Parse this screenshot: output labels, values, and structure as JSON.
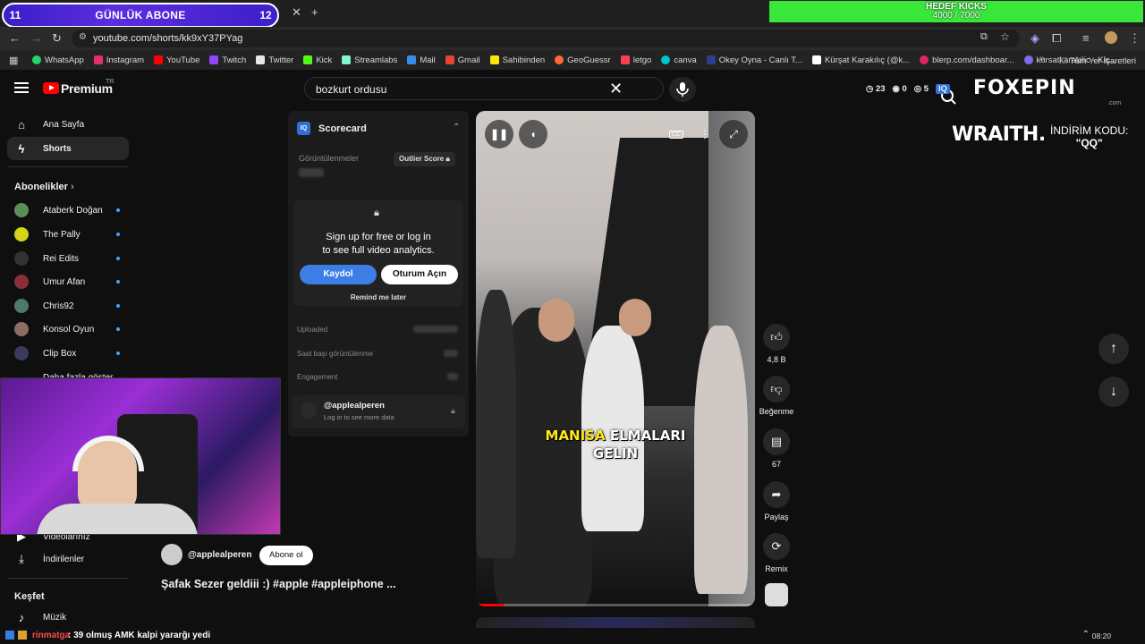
{
  "overlays": {
    "sub_goal": {
      "left_num": "11",
      "label": "GÜNLÜK ABONE",
      "right_num": "12"
    },
    "kicks_goal": {
      "label": "HEDEF KICKS",
      "value": "4000 / 7000"
    },
    "promo": {
      "brand": "FOXEPIN",
      "brand_sub": ".com",
      "sponsor": "WRAITH.",
      "code_line1": "İNDİRİM KODU:",
      "code_line2": "\"QQ\""
    }
  },
  "browser": {
    "url": "youtube.com/shorts/kk9xY37PYag",
    "bookmarks": [
      {
        "label": "WhatsApp",
        "color": "#25d366"
      },
      {
        "label": "Instagram",
        "color": "#e1306c"
      },
      {
        "label": "YouTube",
        "color": "#ff0000"
      },
      {
        "label": "Twitch",
        "color": "#9146ff"
      },
      {
        "label": "Twitter",
        "color": "#e7e7e7"
      },
      {
        "label": "Kick",
        "color": "#53fc18"
      },
      {
        "label": "Streamlabs",
        "color": "#80f5d2"
      },
      {
        "label": "Mail",
        "color": "#3a8be8"
      },
      {
        "label": "Gmail",
        "color": "#ea4335"
      },
      {
        "label": "Sahibinden",
        "color": "#ffe800"
      },
      {
        "label": "GeoGuessr",
        "color": "#ff6a3d"
      },
      {
        "label": "letgo",
        "color": "#ff3f55"
      },
      {
        "label": "canva",
        "color": "#00c4cc"
      },
      {
        "label": "Okey Oyna - Canlı T...",
        "color": "#2c3e8f"
      },
      {
        "label": "Kürşat Karakılıç (@k...",
        "color": "#ffffff"
      },
      {
        "label": "blerp.com/dashboar...",
        "color": "#e0245e"
      },
      {
        "label": "kursatkarakilic - Kic...",
        "color": "#7b6cf0"
      }
    ],
    "all_bookmarks": "Tüm Yer İşaretleri",
    "clock": "08:20"
  },
  "yt": {
    "brand": "Premium",
    "brand_region": "TR",
    "search_value": "bozkurt ordusu",
    "ext_counts": [
      "23",
      "0",
      "5"
    ]
  },
  "sidebar": {
    "items": [
      {
        "label": "Ana Sayfa",
        "icon": "home-icon"
      },
      {
        "label": "Shorts",
        "icon": "shorts-icon"
      }
    ],
    "subs_title": "Abonelikler",
    "subs": [
      {
        "label": "Ataberk Doğan",
        "color": "#5b8f5a"
      },
      {
        "label": "The Pally",
        "color": "#d4d41a"
      },
      {
        "label": "Rei Edits",
        "color": "#333333"
      },
      {
        "label": "Umur Afan",
        "color": "#8a2f3a"
      },
      {
        "label": "Chris92",
        "color": "#4e7a6a"
      },
      {
        "label": "Konsol Oyun",
        "color": "#8d6e63"
      },
      {
        "label": "Clip Box",
        "color": "#3a3a5a"
      }
    ],
    "show_more": "Daha fazla göster",
    "your_videos": "Videolarınız",
    "downloads": "İndirilenler",
    "explore_title": "Keşfet",
    "music": "Müzik"
  },
  "scorecard": {
    "title": "Scorecard",
    "views_label": "Görüntülenmeler",
    "outlier": "Outlier Score",
    "signup_line1": "Sign up for free or log in",
    "signup_line2": "to see full video analytics.",
    "register": "Kaydol",
    "login": "Oturum Açın",
    "remind": "Remind me later",
    "uploaded": "Uploaded",
    "hourly": "Saat başı görüntülenme",
    "engagement": "Engagement",
    "channel": "@applealperen",
    "channel_sub": "Log in to see more data"
  },
  "video": {
    "caption_yellow": "MANISA",
    "caption_white": "ELMALARI",
    "caption_line2": "GELIN",
    "progress": 0.1
  },
  "actions": {
    "likes": "4,8 B",
    "dislike": "Beğenme",
    "comments": "67",
    "share": "Paylaş",
    "remix": "Remix"
  },
  "channel": {
    "handle": "@applealperen",
    "subscribe": "Abone ol",
    "title": "Şafak Sezer geldiii :) #apple #appleiphone ..."
  },
  "chat": {
    "name": "rinmatga",
    "message": ": 39 olmuş AMK kalpi yararğı yedi"
  }
}
